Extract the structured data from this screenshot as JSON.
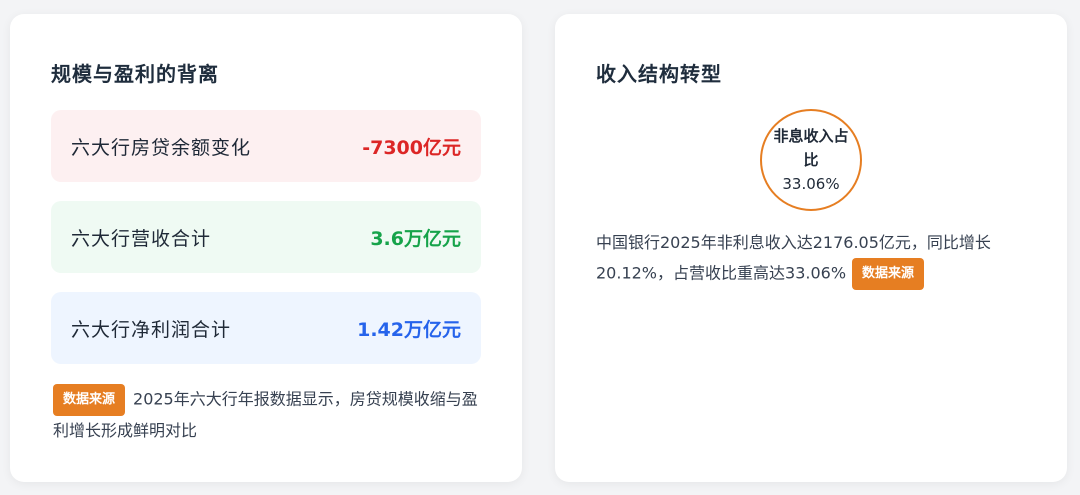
{
  "left_card": {
    "title": "规模与盈利的背离",
    "metrics": [
      {
        "label": "六大行房贷余额变化",
        "value": "-7300亿元"
      },
      {
        "label": "六大行营收合计",
        "value": "3.6万亿元"
      },
      {
        "label": "六大行净利润合计",
        "value": "1.42万亿元"
      }
    ],
    "source_tag": "数据来源",
    "note": "2025年六大行年报数据显示，房贷规模收缩与盈利增长形成鲜明对比"
  },
  "right_card": {
    "title": "收入结构转型",
    "ring_label": "非息收入占比",
    "ring_value": "33.06%",
    "note": "中国银行2025年非利息收入达2176.05亿元，同比增长20.12%，占营收比重高达33.06%",
    "source_tag": "数据来源"
  },
  "colors": {
    "negative": "#dc2626",
    "positive": "#16a34a",
    "blue": "#2563eb",
    "accent": "#e67e22"
  }
}
